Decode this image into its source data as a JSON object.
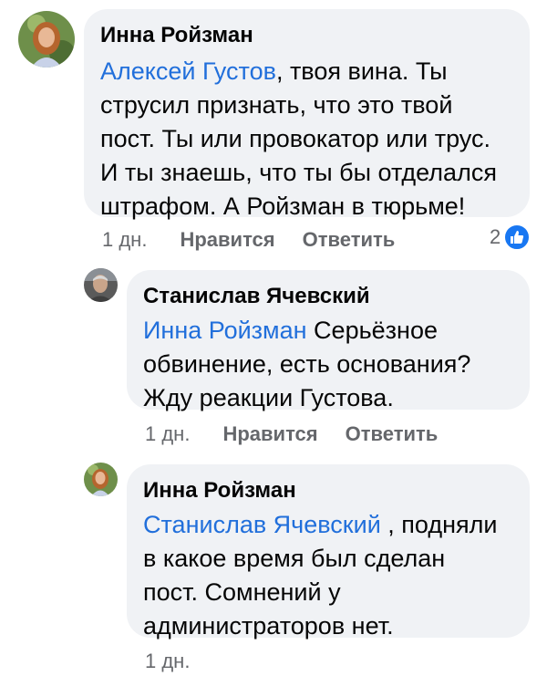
{
  "comments": [
    {
      "author": "Инна Ройзман",
      "mention": "Алексей Густов",
      "text_lines": [
        ", твоя вина. Ты",
        "струсил признать, что это твой",
        "пост. Ты или провокатор или трус.",
        "И ты знаешь, что ты бы отделался",
        "штрафом. А Ройзман в тюрьме!"
      ],
      "time": "1 дн.",
      "like_label": "Нравится",
      "reply_label": "Ответить",
      "reaction_count": "2",
      "reaction_icon": "like-icon"
    },
    {
      "author": "Станислав Ячевский",
      "mention": "Инна Ройзман",
      "text_lines": [
        " Серьёзное",
        "обвинение, есть основания?",
        "Жду реакции Густова."
      ],
      "time": "1 дн.",
      "like_label": "Нравится",
      "reply_label": "Ответить"
    },
    {
      "author": "Инна Ройзман",
      "mention": "Станислав Ячевский",
      "text_lines": [
        " , подняли",
        "в какое время был сделан",
        "пост. Сомнений у",
        "администраторов нет."
      ],
      "time": "1 дн."
    }
  ],
  "colors": {
    "mention": "#216fdb",
    "bubble": "#f0f2f5",
    "meta": "#65676b",
    "like_badge": "#1877f2"
  }
}
